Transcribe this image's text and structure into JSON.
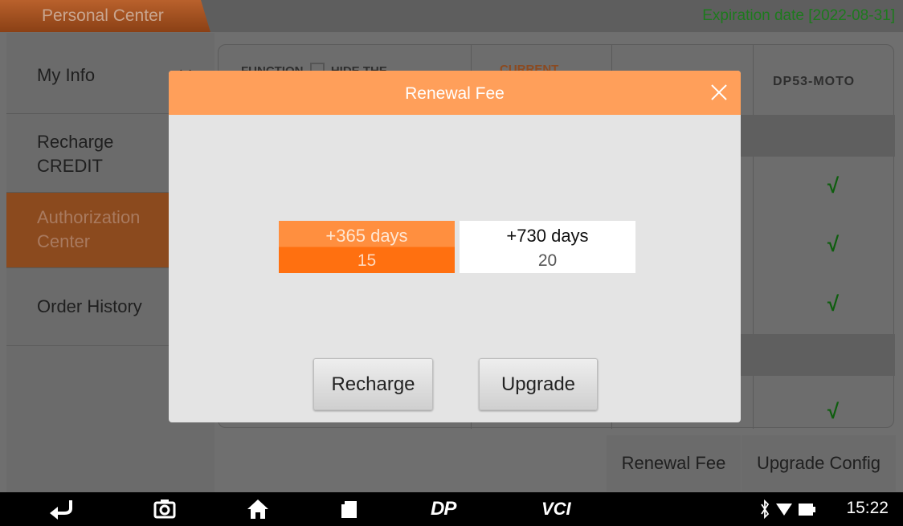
{
  "header": {
    "tab_title": "Personal Center",
    "expiration": "Expiration date [2022-08-31]"
  },
  "sidebar": {
    "items": [
      {
        "label": "My Info"
      },
      {
        "label": "Recharge\nCREDIT"
      },
      {
        "label": "Authorization\nCenter"
      },
      {
        "label": "Order History"
      }
    ]
  },
  "table": {
    "col_function": "FUNCTION",
    "col_hide": "HIDE THE",
    "col_current": "CURRENT",
    "col_model": "DP53-MOTO",
    "check_glyph": "√"
  },
  "bottom_buttons": {
    "renewal": "Renewal Fee",
    "upgrade_config": "Upgrade Config"
  },
  "modal": {
    "title": "Renewal Fee",
    "plans": [
      {
        "days": "+365 days",
        "price": "15",
        "selected": true
      },
      {
        "days": "+730 days",
        "price": "20",
        "selected": false
      }
    ],
    "recharge_label": "Recharge",
    "upgrade_label": "Upgrade"
  },
  "navbar": {
    "dp_label": "DP",
    "vci_label": "VCI",
    "time": "15:22"
  },
  "colors": {
    "accent": "#ff9f5a",
    "selected_plan": "#ff7a20",
    "expiration_text": "#1d7a1d",
    "check": "#0f5e0f"
  }
}
